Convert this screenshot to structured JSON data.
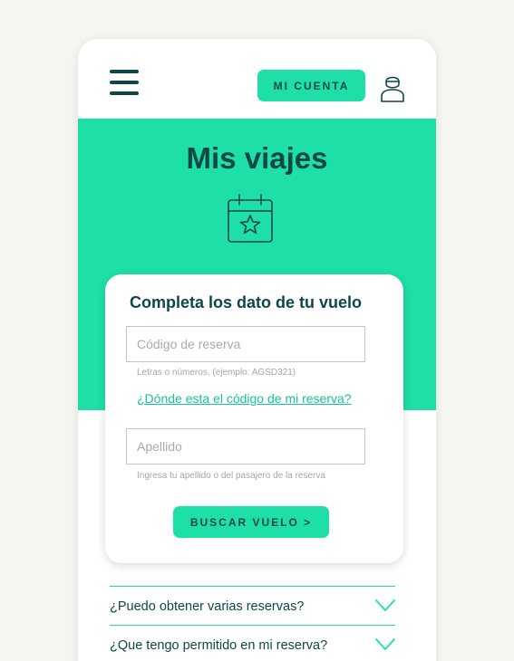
{
  "header": {
    "account_label": "MI CUENTA",
    "menu_icon": "hamburger-menu-icon",
    "user_icon": "user-icon"
  },
  "hero": {
    "title": "Mis viajes",
    "icon": "calendar-star-icon"
  },
  "form": {
    "title": "Completa los dato de tu vuelo",
    "code_placeholder": "Código de reserva",
    "code_value": "",
    "code_hint": "Letras o números, (ejemplo: AGSD321)",
    "help_link": "¿Dónde esta el código de mi reserva?",
    "surname_placeholder": "Apellido",
    "surname_value": "",
    "surname_hint": "Ingresa tu apellido o del pasajero de la reserva",
    "search_label": "BUSCAR VUELO >"
  },
  "faq": {
    "items": [
      {
        "question": "¿Puedo obtener varias reservas?",
        "icon": "chevron-down-icon"
      },
      {
        "question": "¿Que tengo permitido en mi reserva?",
        "icon": "chevron-down-icon"
      }
    ]
  },
  "colors": {
    "accent": "#1ddfa7",
    "text_dark": "#0e4747",
    "link": "#12c792",
    "background": "#f5f6f1"
  }
}
